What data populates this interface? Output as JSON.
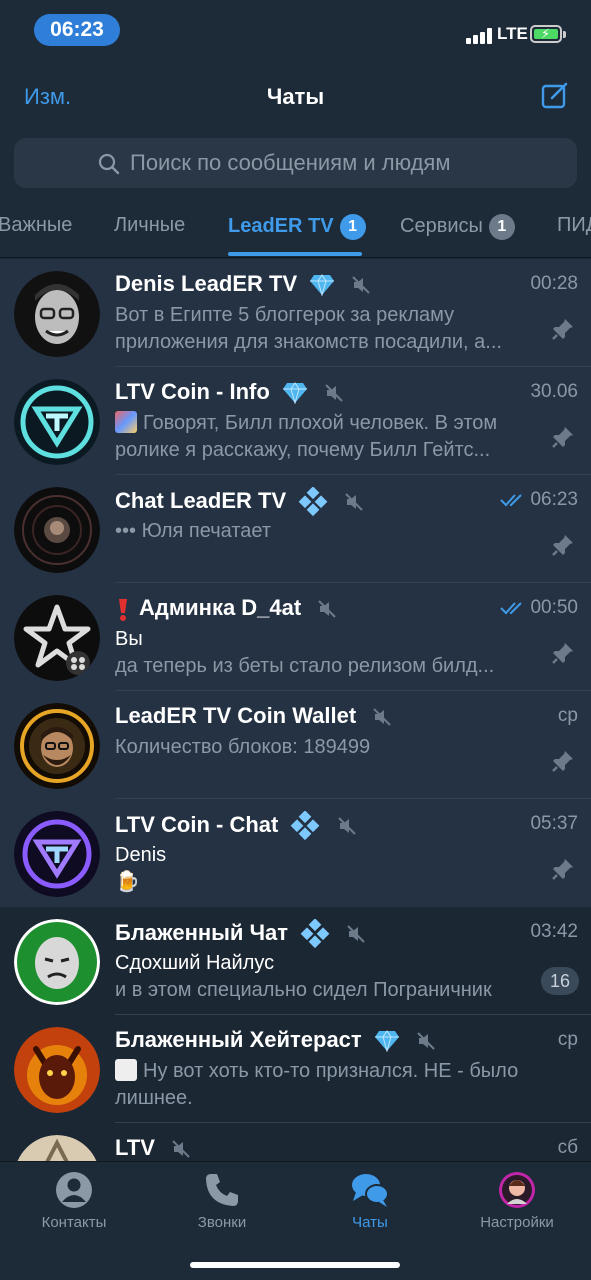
{
  "status_bar": {
    "time": "06:23",
    "network": "LTE"
  },
  "nav": {
    "edit_label": "Изм.",
    "title": "Чаты"
  },
  "search": {
    "placeholder": "Поиск по сообщениям и людям"
  },
  "tabs": [
    {
      "label": "Важные",
      "badge": ""
    },
    {
      "label": "Личные",
      "badge": ""
    },
    {
      "label": "LeadER TV",
      "badge": "1",
      "active": true
    },
    {
      "label": "Сервисы",
      "badge": "1"
    },
    {
      "label": "ПИД",
      "badge": ""
    }
  ],
  "chats": [
    {
      "name": "Denis LeadER TV",
      "badge_icon": "diamond-icon",
      "muted": true,
      "time": "00:28",
      "line1": "Вот в Египте 5 блоггерок за рекламу",
      "line2": "приложения для знакомств посадили, а...",
      "pinned": true
    },
    {
      "name": "LTV Coin - Info",
      "badge_icon": "diamond-icon",
      "muted": true,
      "time": "30.06",
      "line1": "Говорят, Билл плохой человек. В этом",
      "line2": "ролике я расскажу, почему Билл Гейтс...",
      "pinned": true
    },
    {
      "name": "Chat LeadER TV",
      "badge_icon": "crystal-icon",
      "muted": true,
      "time": "06:23",
      "read_checks": true,
      "line1": "••• Юля печатает",
      "line2": "",
      "pinned": true
    },
    {
      "name": "Админка D_4at",
      "badge_icon": "exclamation-icon",
      "muted": true,
      "time": "00:50",
      "read_checks": true,
      "sender": "Вы",
      "line1": "да теперь из беты стало релизом билд...",
      "pinned": true
    },
    {
      "name": "LeadER TV Coin Wallet",
      "badge_icon": "",
      "muted": true,
      "time": "ср",
      "line1": "Количество блоков: 189499",
      "line2": "",
      "pinned": true
    },
    {
      "name": "LTV Coin - Chat",
      "badge_icon": "crystal-icon",
      "muted": true,
      "time": "05:37",
      "sender": "Denis",
      "line1": "🍺",
      "pinned": true
    },
    {
      "name": "Блаженный Чат",
      "badge_icon": "crystal-icon",
      "muted": true,
      "time": "03:42",
      "sender": "Сдохший Найлус",
      "line1": "и в этом специально сидел Пограничник",
      "unread": "16"
    },
    {
      "name": "Блаженный Хейтераст",
      "badge_icon": "diamond-icon",
      "muted": true,
      "time": "ср",
      "line1": "Ну вот хоть кто-то признался. НЕ - было",
      "line2": "лишнее."
    },
    {
      "name": "LTV",
      "badge_icon": "",
      "muted": true,
      "time": "сб",
      "line1": "",
      "line2": ""
    }
  ],
  "tab_bar": [
    {
      "label": "Контакты"
    },
    {
      "label": "Звонки"
    },
    {
      "label": "Чаты",
      "active": true
    },
    {
      "label": "Настройки"
    }
  ],
  "colors": {
    "accent": "#3f9bea",
    "background": "#1c2734",
    "pinned_row": "#243243",
    "muted_text": "#8b98a6"
  }
}
